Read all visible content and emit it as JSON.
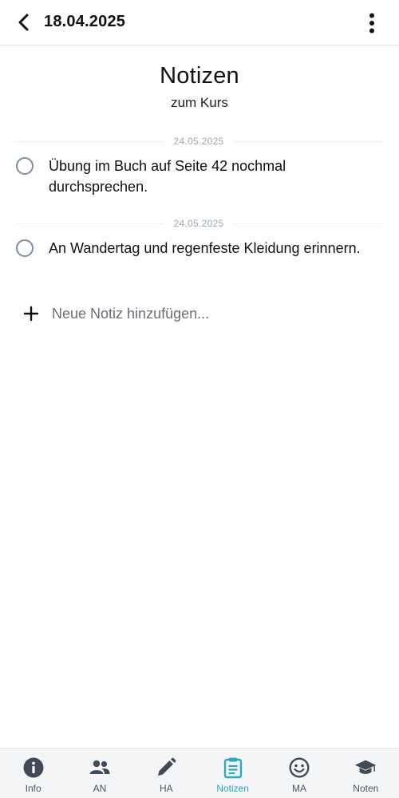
{
  "header": {
    "date": "18.04.2025"
  },
  "page": {
    "title": "Notizen",
    "subtitle": "zum Kurs"
  },
  "notes": [
    {
      "date": "24.05.2025",
      "text": "Übung im Buch auf Seite 42 nochmal durchsprechen."
    },
    {
      "date": "24.05.2025",
      "text": "An Wandertag und regenfeste Kleidung erinnern."
    }
  ],
  "add_note": {
    "placeholder": "Neue Notiz hinzufügen..."
  },
  "nav": {
    "items": [
      {
        "label": "Info",
        "icon": "info-icon"
      },
      {
        "label": "AN",
        "icon": "people-icon"
      },
      {
        "label": "HA",
        "icon": "pencil-icon"
      },
      {
        "label": "Notizen",
        "icon": "clipboard-icon",
        "active": true
      },
      {
        "label": "MA",
        "icon": "smiley-icon"
      },
      {
        "label": "Noten",
        "icon": "graduation-cap-icon"
      }
    ],
    "active_color": "#2aa8c4",
    "inactive_color": "#4a5568"
  }
}
